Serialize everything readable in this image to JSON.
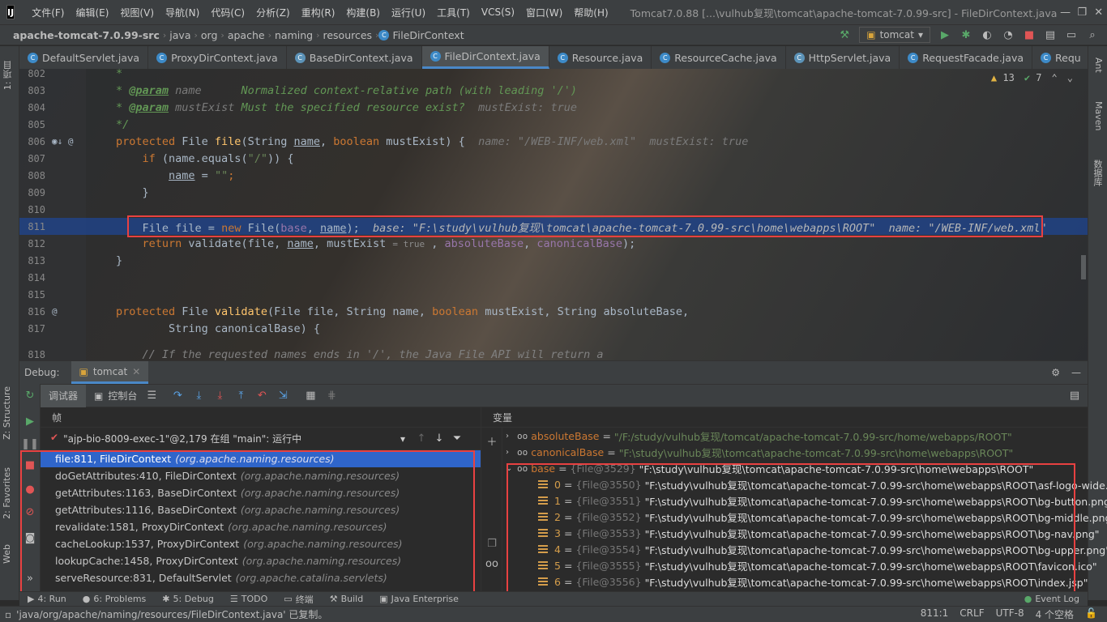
{
  "window": {
    "title": "Tomcat7.0.88 [...\\vulhub复现\\tomcat\\apache-tomcat-7.0.99-src] - FileDirContext.java",
    "min": "—",
    "max": "❐",
    "close": "✕"
  },
  "menu": [
    "文件(F)",
    "编辑(E)",
    "视图(V)",
    "导航(N)",
    "代码(C)",
    "分析(Z)",
    "重构(R)",
    "构建(B)",
    "运行(U)",
    "工具(T)",
    "VCS(S)",
    "窗口(W)",
    "帮助(H)"
  ],
  "logo": "IJ",
  "breadcrumbs": {
    "root": "apache-tomcat-7.0.99-src",
    "items": [
      "java",
      "org",
      "apache",
      "naming",
      "resources"
    ],
    "file": "FileDirContext"
  },
  "run_config": "tomcat",
  "tabs": [
    {
      "label": "DefaultServlet.java"
    },
    {
      "label": "ProxyDirContext.java"
    },
    {
      "label": "BaseDirContext.java"
    },
    {
      "label": "FileDirContext.java",
      "active": true
    },
    {
      "label": "Resource.java"
    },
    {
      "label": "ResourceCache.java"
    },
    {
      "label": "HttpServlet.java"
    },
    {
      "label": "RequestFacade.java"
    },
    {
      "label": "Requ"
    }
  ],
  "inspection": {
    "warnings": "13",
    "weak": "7"
  },
  "left_strip": {
    "project": "1: 项目",
    "structure": "Z: Structure",
    "favorites": "2: Favorites",
    "web": "Web"
  },
  "right_strip": {
    "ant": "Ant",
    "maven": "Maven",
    "db": "数据库"
  },
  "code": {
    "lines": [
      {
        "n": "802"
      },
      {
        "n": "803"
      },
      {
        "n": "804"
      },
      {
        "n": "805"
      },
      {
        "n": "806"
      },
      {
        "n": "807"
      },
      {
        "n": "808"
      },
      {
        "n": "809"
      },
      {
        "n": "810"
      },
      {
        "n": "811"
      },
      {
        "n": "812"
      },
      {
        "n": "813"
      },
      {
        "n": "814"
      },
      {
        "n": "815"
      },
      {
        "n": "816"
      },
      {
        "n": "817"
      },
      {
        "n": "818"
      }
    ],
    "t802": "*",
    "t803a": "* ",
    "t803b": "@param",
    "t803c": " name",
    "t803d": "      Normalized context-relative path (with leading '/')",
    "t804a": "* ",
    "t804b": "@param",
    "t804c": " mustExist",
    "t804d": " Must the specified resource exist?",
    "t804hint": "  mustExist: true",
    "t805": "*/",
    "t806kw": "protected ",
    "t806type": "File ",
    "t806fn": "file",
    "t806a": "(String ",
    "t806name": "name",
    "t806b": ", ",
    "t806kw2": "boolean ",
    "t806c": "mustExist) {",
    "t806hint": "  name: \"/WEB-INF/web.xml\"  mustExist: true",
    "t807kw": "if ",
    "t807a": "(name.equals(",
    "t807s": "\"/\"",
    "t807b": ")) {",
    "t808v": "name",
    "t808a": " = ",
    "t808s": "\"\"",
    "t808b": ";",
    "t809": "}",
    "t811a": "File file = ",
    "t811kw": "new ",
    "t811b": "File(",
    "t811base": "base",
    "t811c": ", ",
    "t811name": "name",
    "t811d": ");",
    "t811hint": "  base: \"F:\\study\\vulhub复现\\tomcat\\apache-tomcat-7.0.99-src\\home\\webapps\\ROOT\"  name: \"/WEB-INF/web.xml\"",
    "t812kw": "return ",
    "t812a": "validate(file, ",
    "t812name": "name",
    "t812b": ", mustExist ",
    "t812inl": "= true",
    "t812c": " , ",
    "t812f1": "absoluteBase",
    "t812d": ", ",
    "t812f2": "canonicalBase",
    "t812e": ");",
    "t813": "}",
    "t816kw": "protected ",
    "t816a": "File ",
    "t816fn": "validate",
    "t816b": "(File file, String name, ",
    "t816kw2": "boolean ",
    "t816c": "mustExist, String absoluteBase,",
    "t817": "String canonicalBase) {",
    "t818": "// If the requested names ends in '/', the Java File API will return a",
    "gutter806": "◉↓ @",
    "gutter816": "@"
  },
  "debug": {
    "label": "Debug:",
    "session": "tomcat",
    "tabs": {
      "debugger": "调试器",
      "console": "控制台"
    },
    "frames_title": "帧",
    "thread": "\"ajp-bio-8009-exec-1\"@2,179 在组 \"main\": 运行中",
    "frames": [
      {
        "loc": "file:811, FileDirContext",
        "pkg": "(org.apache.naming.resources)",
        "sel": true
      },
      {
        "loc": "doGetAttributes:410, FileDirContext",
        "pkg": "(org.apache.naming.resources)"
      },
      {
        "loc": "getAttributes:1163, BaseDirContext",
        "pkg": "(org.apache.naming.resources)"
      },
      {
        "loc": "getAttributes:1116, BaseDirContext",
        "pkg": "(org.apache.naming.resources)"
      },
      {
        "loc": "revalidate:1581, ProxyDirContext",
        "pkg": "(org.apache.naming.resources)"
      },
      {
        "loc": "cacheLookup:1537, ProxyDirContext",
        "pkg": "(org.apache.naming.resources)"
      },
      {
        "loc": "lookupCache:1458, ProxyDirContext",
        "pkg": "(org.apache.naming.resources)"
      },
      {
        "loc": "serveResource:831, DefaultServlet",
        "pkg": "(org.apache.catalina.servlets)"
      }
    ],
    "vars_title": "变量",
    "vars": {
      "absoluteBase": {
        "name": "absoluteBase",
        "value": "\"/F:/study/vulhub复现/tomcat/apache-tomcat-7.0.99-src/home/webapps/ROOT\""
      },
      "canonicalBase": {
        "name": "canonicalBase",
        "value": "\"F:\\study\\vulhub复现\\tomcat\\apache-tomcat-7.0.99-src\\home\\webapps\\ROOT\""
      },
      "base": {
        "name": "base",
        "id": "{File@3529}",
        "value": "\"F:\\study\\vulhub复现\\tomcat\\apache-tomcat-7.0.99-src\\home\\webapps\\ROOT\""
      }
    },
    "items": [
      {
        "i": "0",
        "id": "{File@3550}",
        "v": "\"F:\\study\\vulhub复现\\tomcat\\apache-tomcat-7.0.99-src\\home\\webapps\\ROOT\\asf-logo-wide.svg\""
      },
      {
        "i": "1",
        "id": "{File@3551}",
        "v": "\"F:\\study\\vulhub复现\\tomcat\\apache-tomcat-7.0.99-src\\home\\webapps\\ROOT\\bg-button.png\""
      },
      {
        "i": "2",
        "id": "{File@3552}",
        "v": "\"F:\\study\\vulhub复现\\tomcat\\apache-tomcat-7.0.99-src\\home\\webapps\\ROOT\\bg-middle.png\""
      },
      {
        "i": "3",
        "id": "{File@3553}",
        "v": "\"F:\\study\\vulhub复现\\tomcat\\apache-tomcat-7.0.99-src\\home\\webapps\\ROOT\\bg-nav.png\""
      },
      {
        "i": "4",
        "id": "{File@3554}",
        "v": "\"F:\\study\\vulhub复现\\tomcat\\apache-tomcat-7.0.99-src\\home\\webapps\\ROOT\\bg-upper.png\""
      },
      {
        "i": "5",
        "id": "{File@3555}",
        "v": "\"F:\\study\\vulhub复现\\tomcat\\apache-tomcat-7.0.99-src\\home\\webapps\\ROOT\\favicon.ico\""
      },
      {
        "i": "6",
        "id": "{File@3556}",
        "v": "\"F:\\study\\vulhub复现\\tomcat\\apache-tomcat-7.0.99-src\\home\\webapps\\ROOT\\index.jsp\""
      }
    ]
  },
  "bottom_tabs": [
    "4: Run",
    "6: Problems",
    "5: Debug",
    "TODO",
    "终端",
    "Build",
    "Java Enterprise",
    "Event Log"
  ],
  "status": {
    "message": "'java/org/apache/naming/resources/FileDirContext.java' 已复制。",
    "pos": "811:1",
    "eol": "CRLF",
    "enc": "UTF-8",
    "indent": "4 个空格"
  },
  "colors": {
    "accent": "#4a88c7",
    "highlight": "#214283",
    "selection": "#2f65ca",
    "annotation_box": "#e84141"
  }
}
